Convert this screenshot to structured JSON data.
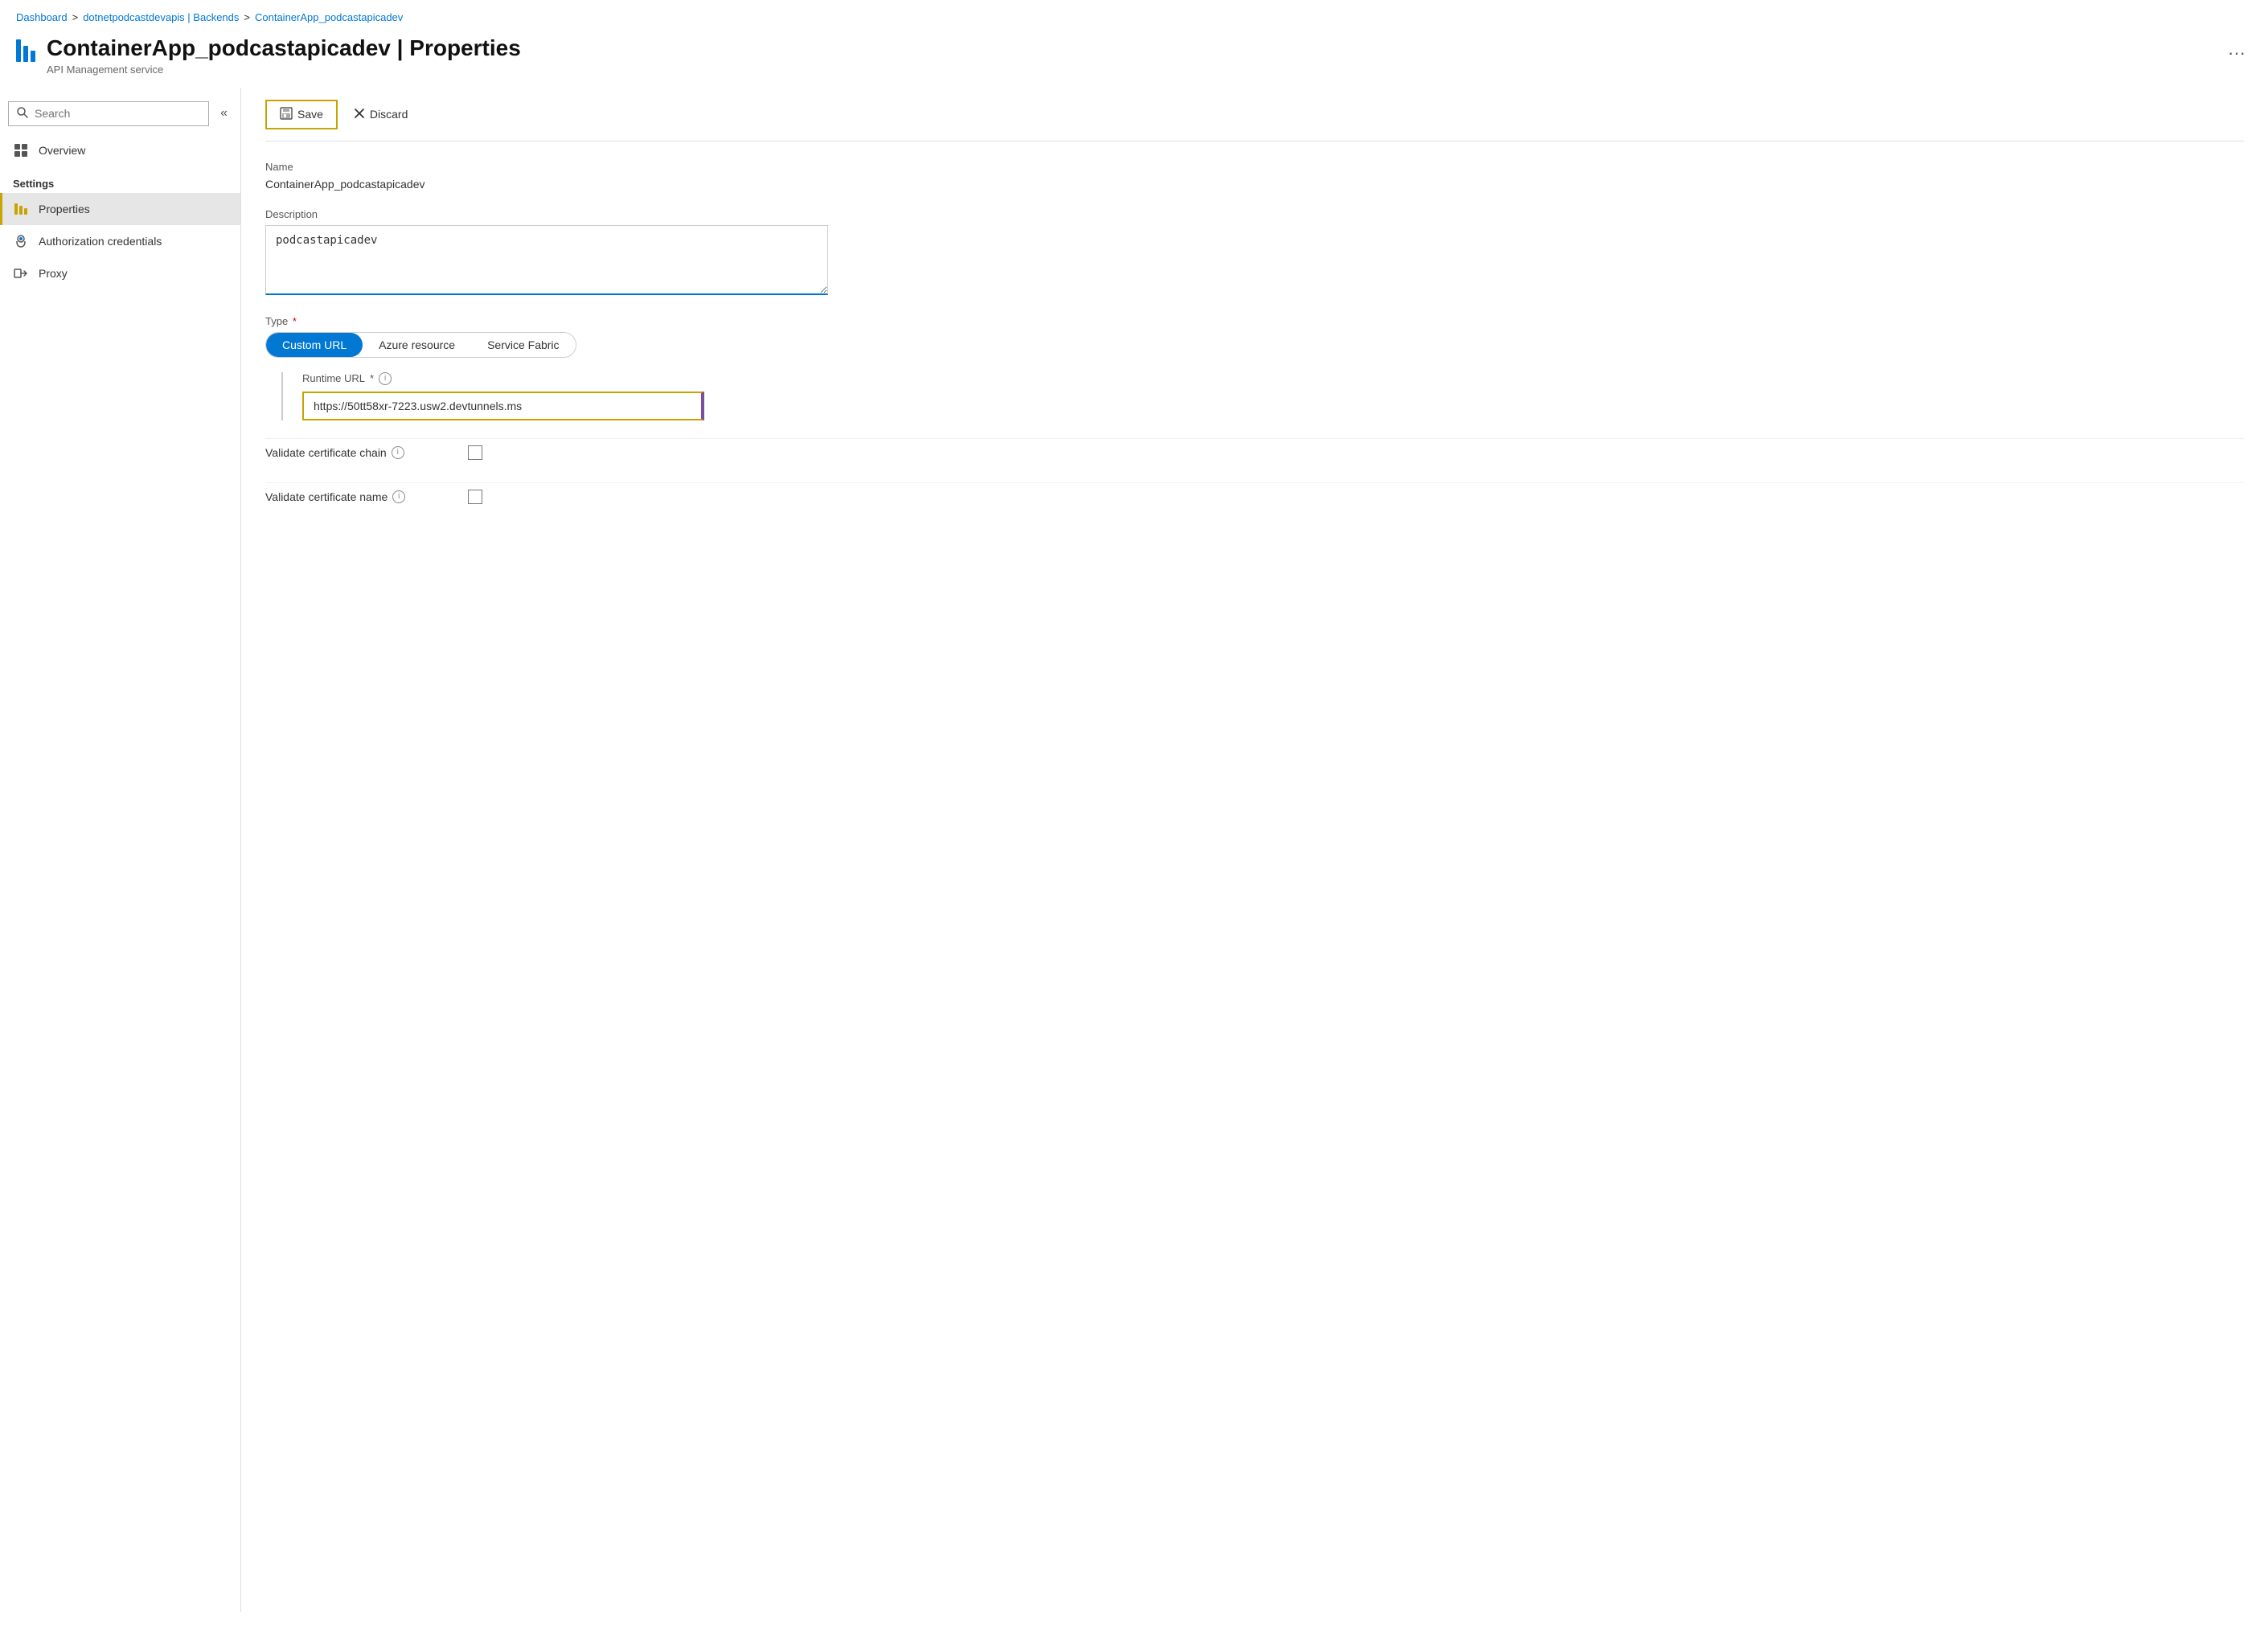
{
  "breadcrumb": {
    "items": [
      {
        "label": "Dashboard",
        "href": true
      },
      {
        "label": "dotnetpodcastdevapis | Backends",
        "href": true
      },
      {
        "label": "ContainerApp_podcastapicadev",
        "href": true
      }
    ],
    "separator": ">"
  },
  "header": {
    "title": "ContainerApp_podcastapicadev | Properties",
    "subtitle": "API Management service",
    "more_button_label": "···"
  },
  "sidebar": {
    "search_placeholder": "Search",
    "collapse_label": "«",
    "nav_items": [
      {
        "id": "overview",
        "label": "Overview",
        "icon": "overview-icon",
        "active": false,
        "section": null
      },
      {
        "id": "properties",
        "label": "Properties",
        "icon": "properties-icon",
        "active": true,
        "section": "Settings"
      },
      {
        "id": "authorization-credentials",
        "label": "Authorization credentials",
        "icon": "auth-icon",
        "active": false,
        "section": null
      },
      {
        "id": "proxy",
        "label": "Proxy",
        "icon": "proxy-icon",
        "active": false,
        "section": null
      }
    ],
    "settings_section_label": "Settings"
  },
  "toolbar": {
    "save_label": "Save",
    "discard_label": "Discard"
  },
  "form": {
    "name_label": "Name",
    "name_value": "ContainerApp_podcastapicadev",
    "description_label": "Description",
    "description_value": "podcastapicadev",
    "type_label": "Type",
    "type_required": true,
    "type_options": [
      {
        "label": "Custom URL",
        "selected": true
      },
      {
        "label": "Azure resource",
        "selected": false
      },
      {
        "label": "Service Fabric",
        "selected": false
      }
    ],
    "runtime_url_label": "Runtime URL",
    "runtime_url_required": true,
    "runtime_url_value": "https://50tt58xr-7223.usw2.devtunnels.ms",
    "validate_cert_chain_label": "Validate certificate chain",
    "validate_cert_name_label": "Validate certificate name"
  }
}
